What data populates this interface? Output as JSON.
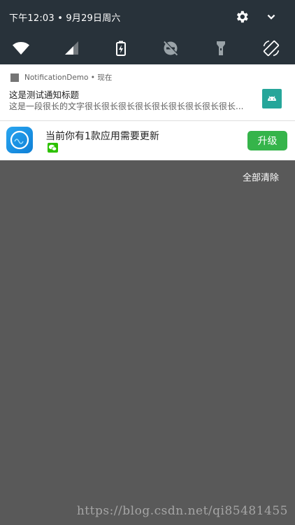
{
  "status_bar": {
    "datetime": "下午12:03 • 9月29日周六"
  },
  "quick_settings": [
    "wifi-icon",
    "cellular-signal-icon",
    "battery-charging-icon",
    "do-not-disturb-off-icon",
    "flashlight-icon",
    "auto-rotate-icon"
  ],
  "notifications": [
    {
      "app_name": "NotificationDemo • 现在",
      "title": "这是测试通知标题",
      "text": "这是一段很长的文字很长很长很长很长很长很长很长很长很长...",
      "large_icon": "android-icon",
      "accent": "#26a69a"
    },
    {
      "title": "当前你有1款应用需要更新",
      "app_icon": "nxc-app-icon",
      "sub_icon": "wechat-icon",
      "button_label": "升级",
      "button_color": "#35b44a"
    }
  ],
  "clear_all_label": "全部清除",
  "watermark": "https://blog.csdn.net/qi85481455"
}
